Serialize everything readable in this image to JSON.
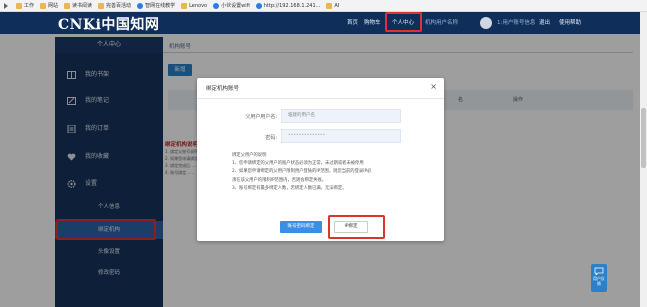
{
  "bookmarks": [
    {
      "label": "工作",
      "icon": "folder-icon"
    },
    {
      "label": "网站",
      "icon": "folder-icon"
    },
    {
      "label": "读书阅读",
      "icon": "folder-icon"
    },
    {
      "label": "完善百活动",
      "icon": "folder-icon"
    },
    {
      "label": "智网在线教学",
      "icon": "edge-icon"
    },
    {
      "label": "Lenovo",
      "icon": "folder-icon"
    },
    {
      "label": "小伙设置wifi",
      "icon": "edge-icon"
    },
    {
      "label": "http://192.168.1.241...",
      "icon": "edge-icon"
    },
    {
      "label": "AI",
      "icon": "folder-icon"
    }
  ],
  "topnav": {
    "logo_main": "CNKi中国知网",
    "logo_sub": "cnki.net",
    "home": "首页",
    "cart": "购物车",
    "personal_center": "个人中心",
    "user_info": "机构用户名称",
    "user_account": "1:用户账号信息",
    "logout": "退出",
    "help": "使用帮助"
  },
  "sidebar": {
    "heading": "个人中心",
    "items": [
      {
        "label": "我的书架",
        "icon": "bookshelf-icon"
      },
      {
        "label": "我的笔记",
        "icon": "note-icon"
      },
      {
        "label": "我的订单",
        "icon": "order-icon"
      },
      {
        "label": "我的收藏",
        "icon": "favorite-icon"
      },
      {
        "label": "设置",
        "icon": "gear-icon"
      }
    ],
    "subitems": [
      "个人信息",
      "绑定机构",
      "头像设置",
      "修改密码"
    ]
  },
  "main": {
    "tab": "机构账号",
    "add_button": "新增",
    "table_headers": [
      "名",
      "操作"
    ],
    "instructions_title": "绑定机构说明",
    "instruction_lines": [
      "1. 绑定父账号说明……",
      "2. 如果您申请绑定的父用户……",
      "3. 绑定完成后……",
      "4. 账号绑定……"
    ]
  },
  "modal": {
    "title": "绑定机构账号",
    "close": "×",
    "username_label": "父用户用户名:",
    "username_value": "临建的用户名",
    "password_label": "密码:",
    "password_value": "••••••••••••••",
    "notes_title": "绑定父用户的说明",
    "notes": [
      "1、您申请绑定的父用户的账户状态必须为正常，未过期或者未被停用",
      "2、如果您申请绑定的父用户限制用户登陆的IP范围，则您当前的登录IP必",
      "须在该父用户的限制IP范围内，否则会绑定失败。",
      "3、账号绑定有最多绑定人数，若绑定人数已满，无法绑定。"
    ],
    "bind_button": "账号密码绑定",
    "ip_button": "IP绑定"
  },
  "feedback": "用户反馈",
  "colors": {
    "accent": "#2a80c9",
    "nav": "#0f2f5a",
    "highlight": "#e03131"
  }
}
